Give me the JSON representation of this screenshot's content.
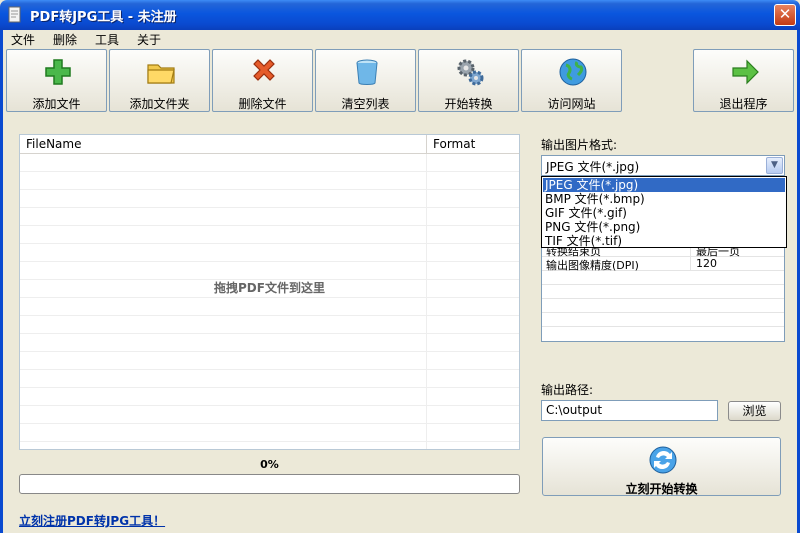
{
  "window": {
    "title": "PDF转JPG工具 - 未注册",
    "close_glyph": "✕"
  },
  "menu": [
    "文件",
    "删除",
    "工具",
    "关于"
  ],
  "toolbar": {
    "add_file": "添加文件",
    "add_folder": "添加文件夹",
    "delete_file": "删除文件",
    "clear_list": "清空列表",
    "start": "开始转换",
    "visit_site": "访问网站",
    "exit": "退出程序"
  },
  "file_list": {
    "col_filename": "FileName",
    "col_format": "Format",
    "drop_hint": "拖拽PDF文件到这里"
  },
  "progress": {
    "percent_text": "0%",
    "value": 0
  },
  "register_link": "立刻注册PDF转JPG工具！",
  "output_format": {
    "label": "输出图片格式:",
    "selected": "JPEG 文件(*.jpg)",
    "options": [
      "JPEG 文件(*.jpg)",
      "BMP 文件(*.bmp)",
      "GIF 文件(*.gif)",
      "PNG 文件(*.png)",
      "TIF 文件(*.tif)"
    ]
  },
  "settings": {
    "rows": [
      {
        "key": "转换结束页",
        "value": "最后一页"
      },
      {
        "key": "输出图像精度(DPI)",
        "value": "120"
      }
    ]
  },
  "output_path": {
    "label": "输出路径:",
    "value": "C:\\output",
    "browse": "浏览"
  },
  "convert_button": "立刻开始转换"
}
